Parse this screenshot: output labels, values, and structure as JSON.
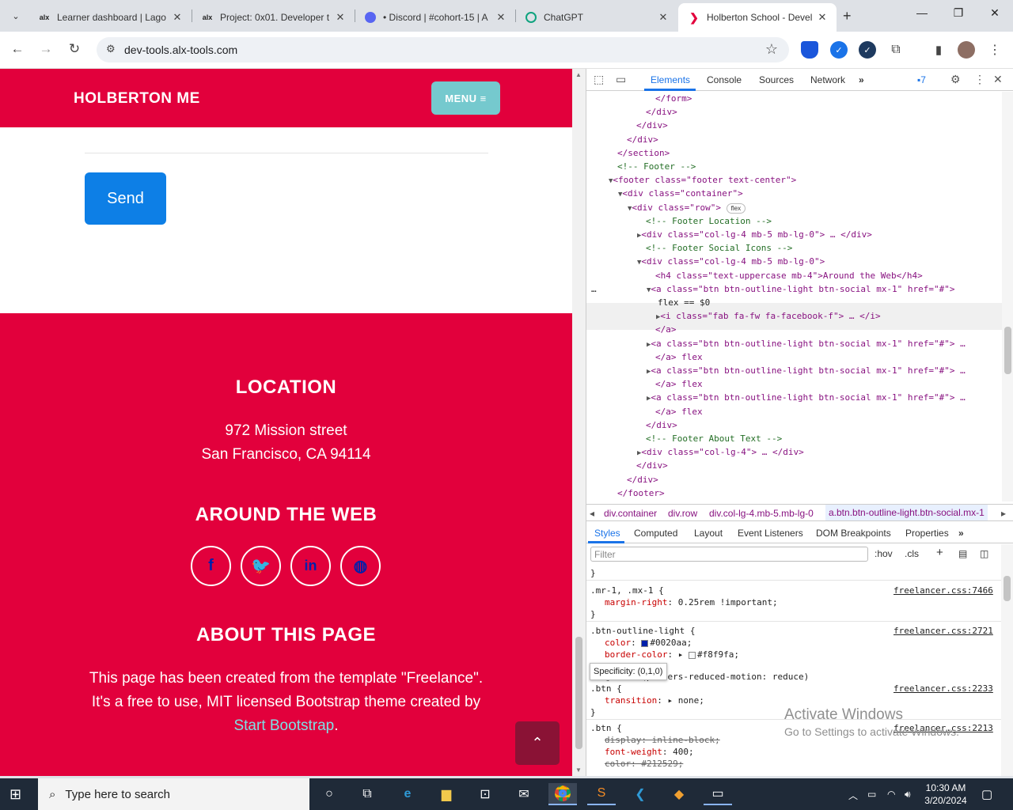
{
  "browser": {
    "tabs": [
      {
        "favicon": "alx",
        "title": "Learner dashboard | Lago"
      },
      {
        "favicon": "alx",
        "title": "Project: 0x01. Developer t"
      },
      {
        "favicon": "discord-icon",
        "title": "• Discord | #cohort-15 | A"
      },
      {
        "favicon": "chatgpt-icon",
        "title": "ChatGPT"
      },
      {
        "favicon": "holberton-icon",
        "title": "Holberton School - Devel",
        "active": true
      }
    ],
    "url": "dev-tools.alx-tools.com"
  },
  "site": {
    "brand": "HOLBERTON ME",
    "menu_label": "MENU ≡",
    "send_label": "Send",
    "location_title": "LOCATION",
    "address_line1": "972 Mission street",
    "address_line2": "San Francisco, CA 94114",
    "web_title": "AROUND THE WEB",
    "social": [
      "f",
      "t",
      "in",
      "dribbble"
    ],
    "about_title": "ABOUT THIS PAGE",
    "about_line1": "This page has been created from the template \"Freelance\".",
    "about_line2": "It's a free to use, MIT licensed Bootstrap theme created by",
    "about_link": "Start Bootstrap",
    "about_end": ".",
    "to_top": "⌃"
  },
  "devtools": {
    "tabs": [
      "Elements",
      "Console",
      "Sources",
      "Network"
    ],
    "issues_count": "7",
    "dom": [
      "</form>",
      "</div>",
      "</div>",
      "</div>",
      "</section>",
      "<!-- Footer -->",
      "<footer class=\"footer text-center\">",
      "<div class=\"container\">",
      "<div class=\"row\">",
      "<!-- Footer Location -->",
      "<div class=\"col-lg-4 mb-5 mb-lg-0\"> … </div>",
      "<!-- Footer Social Icons -->",
      "<div class=\"col-lg-4 mb-5 mb-lg-0\">",
      "<h4 class=\"text-uppercase mb-4\">Around the Web</h4>",
      "<a class=\"btn btn-outline-light btn-social mx-1\" href=\"#\">",
      "flex == $0",
      "<i class=\"fab fa-fw fa-facebook-f\"> … </i>",
      "</a>",
      "<a class=\"btn btn-outline-light btn-social mx-1\" href=\"#\"> …",
      "</a> flex",
      "<a class=\"btn btn-outline-light btn-social mx-1\" href=\"#\"> …",
      "</a> flex",
      "<a class=\"btn btn-outline-light btn-social mx-1\" href=\"#\"> …",
      "</a> flex",
      "</div>",
      "<!-- Footer About Text -->",
      "<div class=\"col-lg-4\"> … </div>",
      "</div>",
      "</div>",
      "</footer>"
    ],
    "breadcrumbs": [
      "div.container",
      "div.row",
      "div.col-lg-4.mb-5.mb-lg-0",
      "a.btn.btn-outline-light.btn-social.mx-1"
    ],
    "style_tabs": [
      "Styles",
      "Computed",
      "Layout",
      "Event Listeners",
      "DOM Breakpoints",
      "Properties"
    ],
    "filter_placeholder": "Filter",
    "hov": ":hov",
    "cls": ".cls",
    "styles": {
      "rule1_selector": ".mr-1, .mx-1 {",
      "rule1_src": "freelancer.css:7466",
      "rule1_prop": "margin-right",
      "rule1_val": "0.25rem !important;",
      "rule2_selector": ".btn-outline-light {",
      "rule2_src": "freelancer.css:2721",
      "rule2_prop1": "color",
      "rule2_val1": "#0020aa;",
      "rule2_prop2": "border-color",
      "rule2_val2": "#f8f9fa;",
      "media": "@media (prefers-reduced-motion: reduce)",
      "rule3_selector": ".btn {",
      "rule3_src": "freelancer.css:2233",
      "rule3_prop": "transition",
      "rule3_val": "none;",
      "rule4_selector": ".btn {",
      "rule4_src": "freelancer.css:2213",
      "rule4_prop1": "display: inline-block;",
      "rule4_prop2": "font-weight",
      "rule4_val2": "400;",
      "rule4_prop3": "color: #212529;",
      "close": "}"
    },
    "tooltip": "Specificity: (0,1,0)"
  },
  "watermark": {
    "line1": "Activate Windows",
    "line2": "Go to Settings to activate Windows."
  },
  "taskbar": {
    "search_placeholder": "Type here to search",
    "time": "10:30 AM",
    "date": "3/20/2024"
  },
  "colors": {
    "brand_red": "#e2003c",
    "teal": "#75c9ce",
    "send_blue": "#0d7fe6",
    "social_icon": "#0020aa"
  }
}
